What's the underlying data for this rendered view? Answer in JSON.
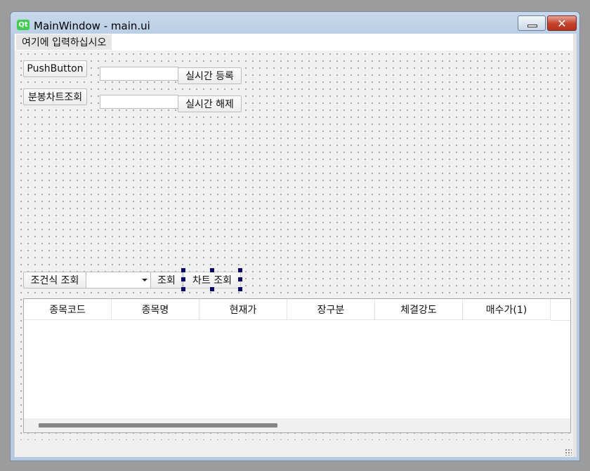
{
  "window": {
    "title": "MainWindow - main.ui",
    "logo_text": "Qt",
    "close_glyph": "✕"
  },
  "menubar": {
    "placeholder": "여기에 입력하십시오"
  },
  "buttons": {
    "push_button": "PushButton",
    "register_realtime": "실시간 등록",
    "candle_chart": "분봉차트조회",
    "release_realtime": "실시간 해제",
    "condition_query": "조건식 조회",
    "query": "조회",
    "chart_query": "차트 조회"
  },
  "inputs": {
    "line1_value": "",
    "line2_value": "",
    "combo_value": ""
  },
  "table": {
    "columns": [
      "종목코드",
      "종목명",
      "현재가",
      "장구분",
      "체결강도",
      "매수가(1)"
    ]
  },
  "colors": {
    "qt_green": "#41cd52",
    "selection_handle": "#0a0a6e",
    "title_gradient": "#b6cbe3"
  },
  "icons": [
    "qt-logo-icon",
    "minimize-icon",
    "close-icon",
    "dropdown-arrow-icon",
    "size-grip-icon"
  ]
}
